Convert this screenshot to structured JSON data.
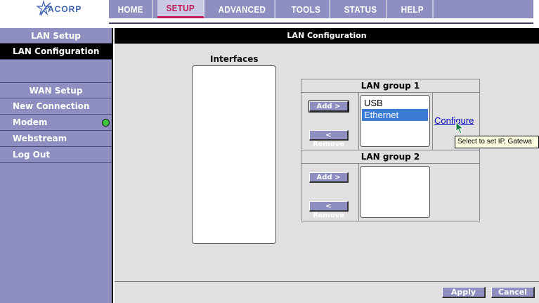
{
  "brand": {
    "logo_text": "ACORP"
  },
  "topnav": {
    "tabs": [
      {
        "label": "HOME"
      },
      {
        "label": "SETUP"
      },
      {
        "label": "ADVANCED"
      },
      {
        "label": "TOOLS"
      },
      {
        "label": "STATUS"
      },
      {
        "label": "HELP"
      }
    ],
    "active": "SETUP"
  },
  "sidebar": {
    "lan_heading": "LAN Setup",
    "lan_config": "LAN Configuration",
    "wan_heading": "WAN Setup",
    "new_connection": "New Connection",
    "modem": "Modem",
    "webstream": "Webstream",
    "logout": "Log Out",
    "modem_status_color": "#3cc63c"
  },
  "main": {
    "title": "LAN Configuration",
    "interfaces_label": "Interfaces",
    "group1": {
      "label": "LAN group 1",
      "add": "Add >",
      "remove": "< Remove",
      "items": [
        "USB",
        "Ethernet"
      ],
      "selected": "Ethernet"
    },
    "group2": {
      "label": "LAN group 2",
      "add": "Add >",
      "remove": "< Remove"
    },
    "configure_link": "Configure",
    "tooltip": "Select to set IP, Gatewa",
    "apply": "Apply",
    "cancel": "Cancel"
  },
  "colors": {
    "nav_bg": "#8e8fc0",
    "active_tab": "#c51b5a",
    "selection": "#3a7bd5",
    "panel_bg": "#e0e0e0"
  }
}
